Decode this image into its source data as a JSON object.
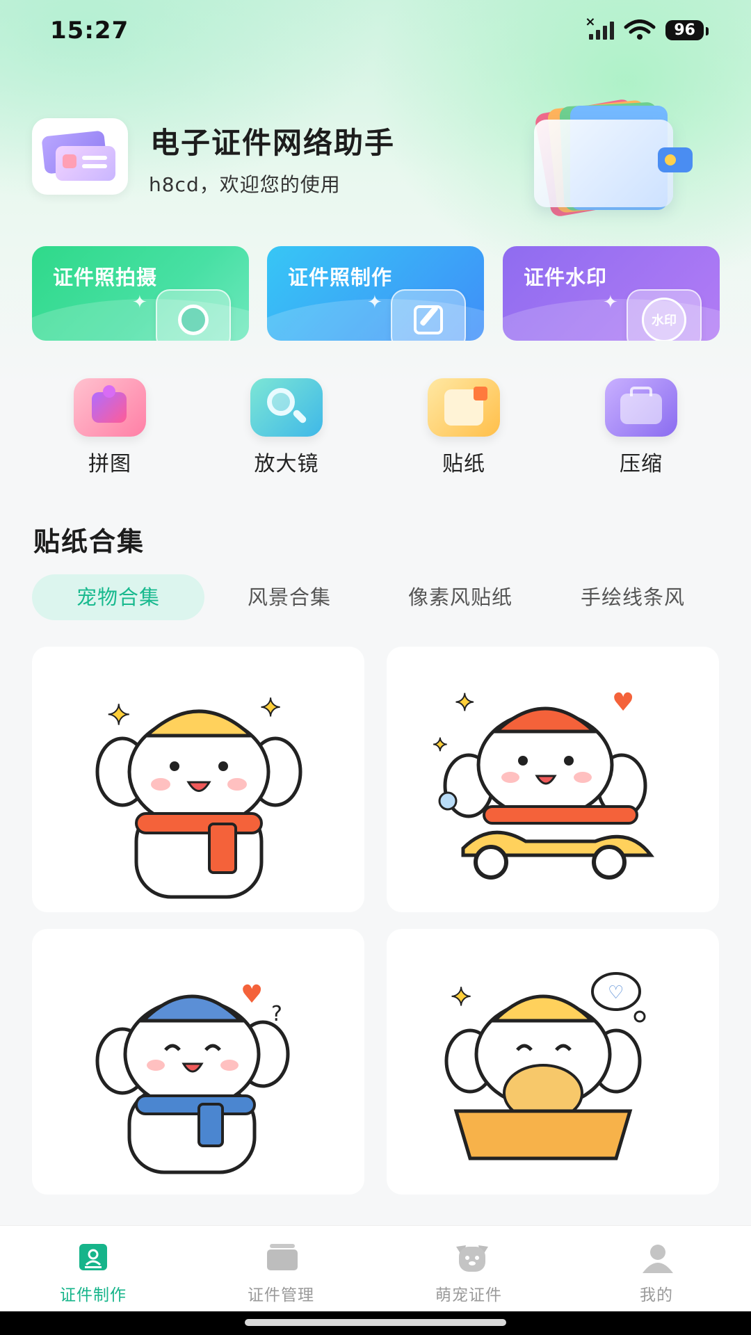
{
  "status": {
    "time": "15:27",
    "battery": "96"
  },
  "header": {
    "title": "电子证件网络助手",
    "subtitle": "h8cd，欢迎您的使用"
  },
  "features": [
    {
      "label": "证件照拍摄"
    },
    {
      "label": "证件照制作"
    },
    {
      "label": "证件水印",
      "badge": "水印"
    }
  ],
  "tools": [
    {
      "label": "拼图",
      "icon": "puzzle-icon"
    },
    {
      "label": "放大镜",
      "icon": "magnifier-icon"
    },
    {
      "label": "贴纸",
      "icon": "sticker-icon"
    },
    {
      "label": "压缩",
      "icon": "compress-icon"
    }
  ],
  "section": {
    "title": "贴纸合集",
    "tabs": [
      {
        "label": "宠物合集",
        "active": true
      },
      {
        "label": "风景合集"
      },
      {
        "label": "像素风贴纸"
      },
      {
        "label": "手绘线条风"
      }
    ]
  },
  "stickers": [
    {
      "icon": "puppy-scarf-sticker",
      "hat": "#ffd15c",
      "scarf": "#f4623a"
    },
    {
      "icon": "puppy-scooter-sticker",
      "hat": "#f4623a",
      "scarf": "#f4623a"
    },
    {
      "icon": "puppy-wave-sticker",
      "hat": "#5b8fd6",
      "scarf": "#4b86d0"
    },
    {
      "icon": "puppy-bread-sticker",
      "hat": "#ffd15c",
      "scarf": "#f7b24a"
    }
  ],
  "bottom_nav": [
    {
      "label": "证件制作",
      "active": true,
      "icon": "id-card-icon"
    },
    {
      "label": "证件管理",
      "icon": "folder-icon"
    },
    {
      "label": "萌宠证件",
      "icon": "pet-icon"
    },
    {
      "label": "我的",
      "icon": "user-icon"
    }
  ],
  "colors": {
    "accent": "#16b48a",
    "tab_active_bg": "#dcf5ee"
  }
}
